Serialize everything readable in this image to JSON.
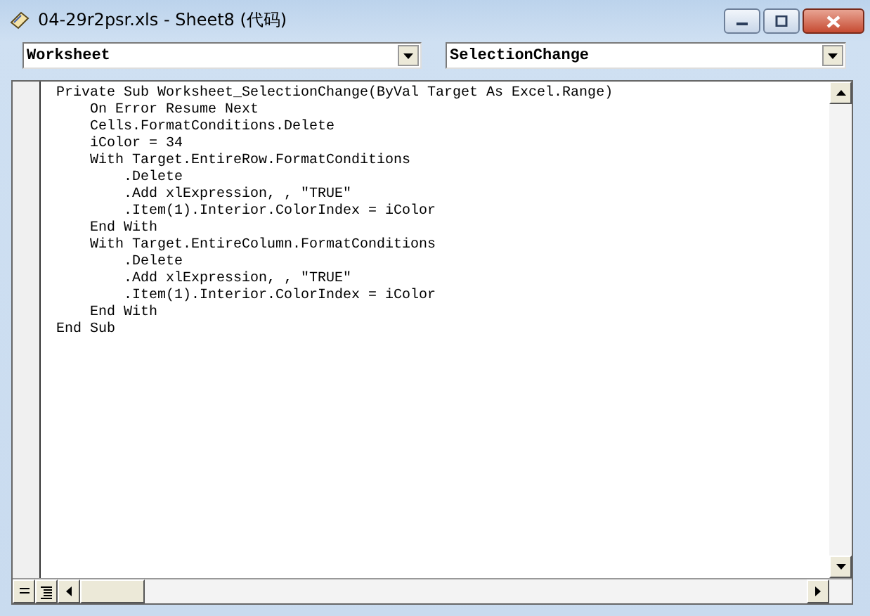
{
  "window": {
    "title": "04-29r2psr.xls - Sheet8 (代码)"
  },
  "object_box": {
    "value": "Worksheet"
  },
  "procedure_box": {
    "value": "SelectionChange"
  },
  "code_lines": [
    "Private Sub Worksheet_SelectionChange(ByVal Target As Excel.Range)",
    "    On Error Resume Next",
    "    Cells.FormatConditions.Delete",
    "    iColor = 34",
    "    With Target.EntireRow.FormatConditions",
    "        .Delete",
    "        .Add xlExpression, , \"TRUE\"",
    "        .Item(1).Interior.ColorIndex = iColor",
    "    End With",
    "    With Target.EntireColumn.FormatConditions",
    "        .Delete",
    "        .Add xlExpression, , \"TRUE\"",
    "        .Item(1).Interior.ColorIndex = iColor",
    "    End With",
    "End Sub"
  ]
}
